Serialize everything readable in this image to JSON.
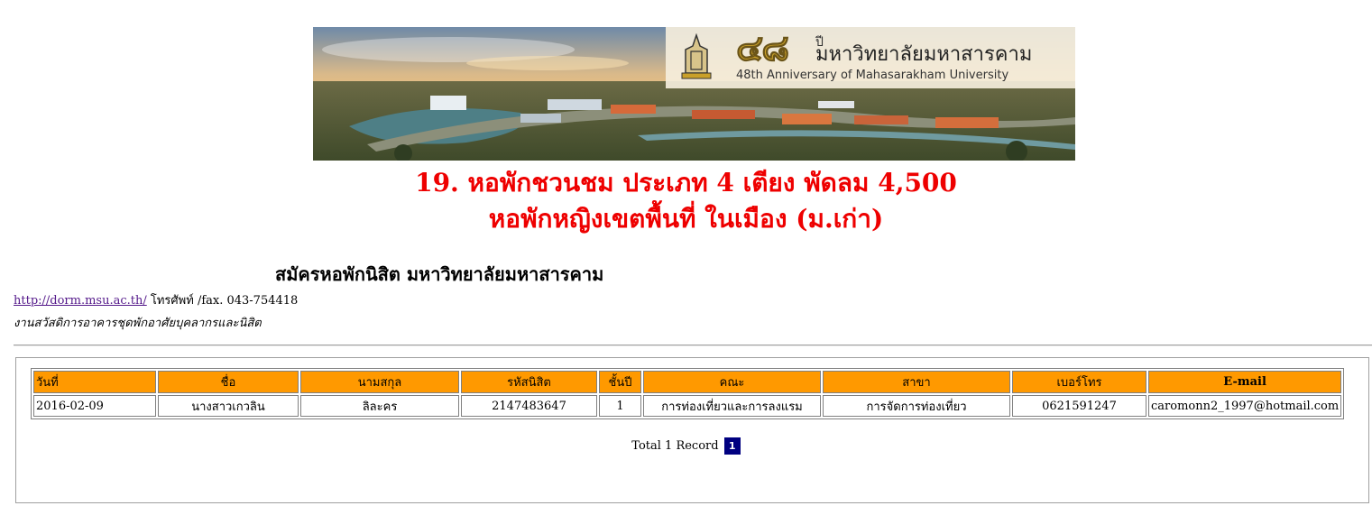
{
  "banner": {
    "anniversary_number": "๔๘",
    "anniversary_pi": "ปี",
    "university_th": "มหาวิทยาลัยมหาสารคาม",
    "anniversary_en": "48th Anniversary of Mahasarakham University"
  },
  "heading": {
    "line1": "19. หอพักชวนชม ประเภท 4 เตียง พัดลม 4,500",
    "line2": "หอพักหญิงเขตพื้นที่ ในเมือง (ม.เก่า)"
  },
  "subtitle": "สมัครหอพักนิสิต มหาวิทยาลัยมหาสารคาม",
  "contact": {
    "link_text": "http://dorm.msu.ac.th/",
    "phone_text": " โทรศัพท์ /fax. 043-754418",
    "department": "งานสวัสดิการอาคารชุดพักอาศัยบุคลากรและนิสิต"
  },
  "table": {
    "headers": [
      "วันที่",
      "ชื่อ",
      "นามสกุล",
      "รหัสนิสิต",
      "ชั้นปี",
      "คณะ",
      "สาขา",
      "เบอร์โทร",
      "E-mail"
    ],
    "rows": [
      [
        "2016-02-09",
        "นางสาวเกวลิน",
        "ลิละคร",
        "2147483647",
        "1",
        "การท่องเที่ยวและการลงแรม",
        "การจัดการท่องเที่ยว",
        "0621591247",
        "caromonn2_1997@hotmail.com"
      ]
    ]
  },
  "pager": {
    "summary": "Total 1 Record",
    "current_page": "1"
  },
  "colors": {
    "title_red": "#ee0000",
    "header_orange": "#ff9900",
    "pager_navy": "#000080"
  }
}
